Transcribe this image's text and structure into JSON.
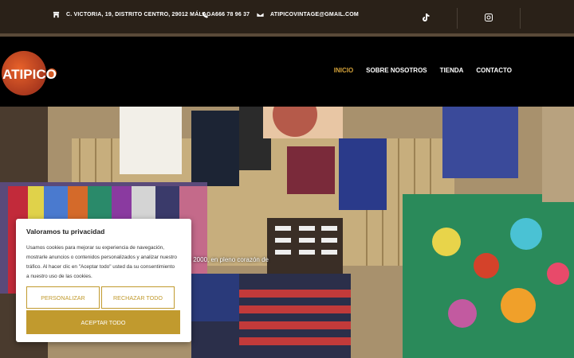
{
  "topbar": {
    "address": "C. VICTORIA, 19, DISTRITO CENTRO, 29012 MÁLAGA",
    "phone": "666 78 96 37",
    "email": "ATIPICOVINTAGE@GMAIL.COM",
    "icons": [
      "store-icon",
      "phone-icon",
      "mail-icon",
      "tiktok-icon",
      "instagram-icon"
    ]
  },
  "header": {
    "logo_text": "ATIPICO",
    "nav": [
      {
        "label": "INICIO",
        "active": true
      },
      {
        "label": "SOBRE NOSOTROS",
        "active": false
      },
      {
        "label": "TIENDA",
        "active": false
      },
      {
        "label": "CONTACTO",
        "active": false
      }
    ]
  },
  "hero": {
    "partial_text": "s 2000, en pleno corazón de"
  },
  "cookie": {
    "title": "Valoramos tu privacidad",
    "body": "Usamos cookies para mejorar su experiencia de navegación, mostrarle anuncios o contenidos personalizados y analizar nuestro tráfico. Al hacer clic en \"Aceptar todo\" usted da su consentimiento a nuestro uso de las cookies.",
    "customize_label": "PERSONALIZAR",
    "reject_label": "RECHAZAR TODO",
    "accept_label": "ACEPTAR TODO"
  },
  "colors": {
    "accent": "#c19a2e",
    "nav_active": "#d4a23a",
    "topbar_bg": "#2a2118",
    "header_bg": "#000000"
  }
}
